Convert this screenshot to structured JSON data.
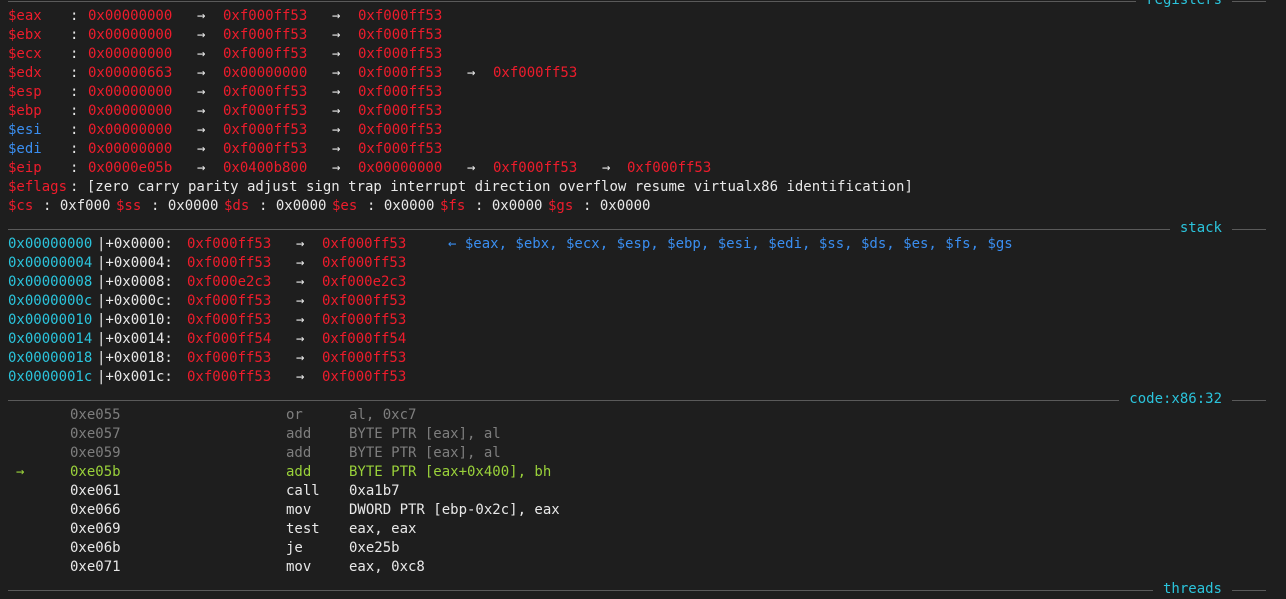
{
  "sections": {
    "registers_title": "registers",
    "stack_title": "stack",
    "code_title": "code:x86:32",
    "threads_title": "threads"
  },
  "arrow": "→",
  "back_arrow": "←",
  "registers": [
    {
      "name": "$eax",
      "chain": [
        "0x00000000",
        "0xf000ff53",
        "0xf000ff53"
      ],
      "name_color": "red"
    },
    {
      "name": "$ebx",
      "chain": [
        "0x00000000",
        "0xf000ff53",
        "0xf000ff53"
      ],
      "name_color": "red"
    },
    {
      "name": "$ecx",
      "chain": [
        "0x00000000",
        "0xf000ff53",
        "0xf000ff53"
      ],
      "name_color": "red"
    },
    {
      "name": "$edx",
      "chain": [
        "0x00000663",
        "0x00000000",
        "0xf000ff53",
        "0xf000ff53"
      ],
      "name_color": "red"
    },
    {
      "name": "$esp",
      "chain": [
        "0x00000000",
        "0xf000ff53",
        "0xf000ff53"
      ],
      "name_color": "red"
    },
    {
      "name": "$ebp",
      "chain": [
        "0x00000000",
        "0xf000ff53",
        "0xf000ff53"
      ],
      "name_color": "red"
    },
    {
      "name": "$esi",
      "chain": [
        "0x00000000",
        "0xf000ff53",
        "0xf000ff53"
      ],
      "name_color": "blue"
    },
    {
      "name": "$edi",
      "chain": [
        "0x00000000",
        "0xf000ff53",
        "0xf000ff53"
      ],
      "name_color": "blue"
    },
    {
      "name": "$eip",
      "chain": [
        "0x0000e05b",
        "0x0400b800",
        "0x00000000",
        "0xf000ff53",
        "0xf000ff53"
      ],
      "name_color": "red"
    }
  ],
  "eflags": {
    "label": "$eflags",
    "value": ": [zero carry parity adjust sign trap interrupt direction overflow resume virtualx86 identification]"
  },
  "segments": [
    {
      "name": "$cs",
      "value": ": 0xf000"
    },
    {
      "name": "$ss",
      "value": ": 0x0000"
    },
    {
      "name": "$ds",
      "value": ": 0x0000"
    },
    {
      "name": "$es",
      "value": ": 0x0000"
    },
    {
      "name": "$fs",
      "value": ": 0x0000"
    },
    {
      "name": "$gs",
      "value": ": 0x0000"
    }
  ],
  "stack": [
    {
      "addr": "0x00000000",
      "offset": "|+0x0000:",
      "v1": "0xf000ff53",
      "v2": "0xf000ff53",
      "note": "← $eax, $ebx, $ecx, $esp, $ebp, $esi, $edi, $ss, $ds, $es, $fs, $gs"
    },
    {
      "addr": "0x00000004",
      "offset": "|+0x0004:",
      "v1": "0xf000ff53",
      "v2": "0xf000ff53",
      "note": ""
    },
    {
      "addr": "0x00000008",
      "offset": "|+0x0008:",
      "v1": "0xf000e2c3",
      "v2": "0xf000e2c3",
      "note": ""
    },
    {
      "addr": "0x0000000c",
      "offset": "|+0x000c:",
      "v1": "0xf000ff53",
      "v2": "0xf000ff53",
      "note": ""
    },
    {
      "addr": "0x00000010",
      "offset": "|+0x0010:",
      "v1": "0xf000ff53",
      "v2": "0xf000ff53",
      "note": ""
    },
    {
      "addr": "0x00000014",
      "offset": "|+0x0014:",
      "v1": "0xf000ff54",
      "v2": "0xf000ff54",
      "note": ""
    },
    {
      "addr": "0x00000018",
      "offset": "|+0x0018:",
      "v1": "0xf000ff53",
      "v2": "0xf000ff53",
      "note": ""
    },
    {
      "addr": "0x0000001c",
      "offset": "|+0x001c:",
      "v1": "0xf000ff53",
      "v2": "0xf000ff53",
      "note": ""
    }
  ],
  "code": [
    {
      "marker": "",
      "addr": "0xe055",
      "mnemonic": "or",
      "operands": "al, 0xc7",
      "state": "past"
    },
    {
      "marker": "",
      "addr": "0xe057",
      "mnemonic": "add",
      "operands": "BYTE PTR [eax], al",
      "state": "past"
    },
    {
      "marker": "",
      "addr": "0xe059",
      "mnemonic": "add",
      "operands": "BYTE PTR [eax], al",
      "state": "past"
    },
    {
      "marker": "→",
      "addr": "0xe05b",
      "mnemonic": "add",
      "operands": "BYTE PTR [eax+0x400], bh",
      "state": "current"
    },
    {
      "marker": "",
      "addr": "0xe061",
      "mnemonic": "call",
      "operands": "0xa1b7",
      "state": "future"
    },
    {
      "marker": "",
      "addr": "0xe066",
      "mnemonic": "mov",
      "operands": "DWORD PTR [ebp-0x2c], eax",
      "state": "future"
    },
    {
      "marker": "",
      "addr": "0xe069",
      "mnemonic": "test",
      "operands": "eax, eax",
      "state": "future"
    },
    {
      "marker": "",
      "addr": "0xe06b",
      "mnemonic": "je",
      "operands": "0xe25b",
      "state": "future"
    },
    {
      "marker": "",
      "addr": "0xe071",
      "mnemonic": "mov",
      "operands": "eax, 0xc8",
      "state": "future"
    }
  ]
}
